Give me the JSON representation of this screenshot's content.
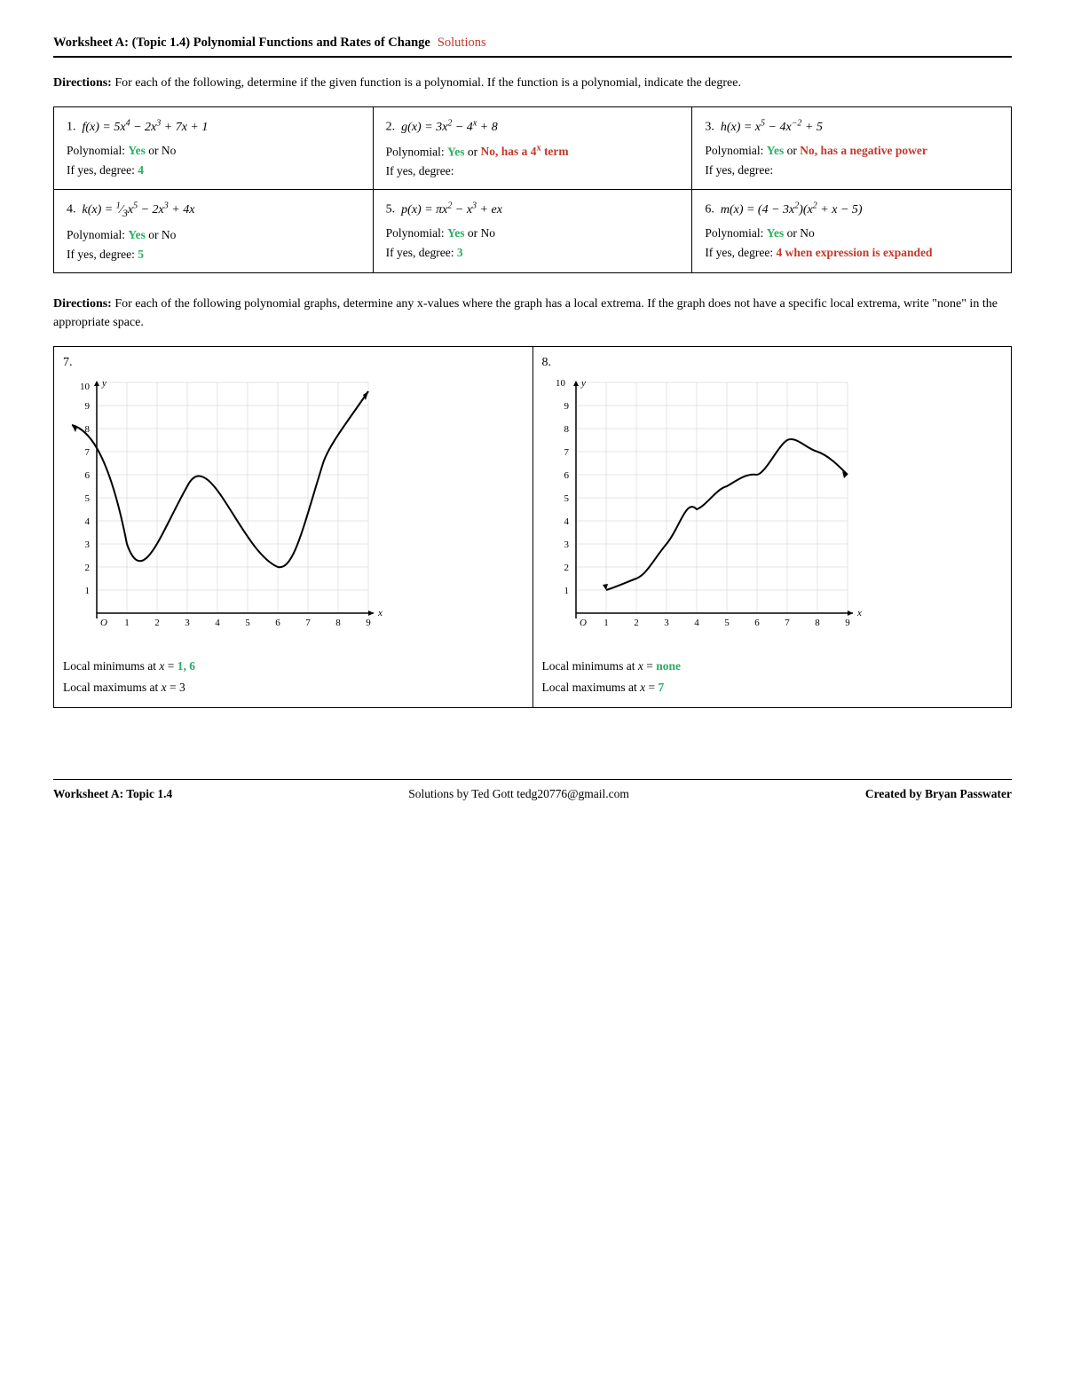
{
  "header": {
    "title": "Worksheet A: (Topic 1.4) Polynomial Functions and Rates of Change",
    "solutions": "Solutions"
  },
  "directions1": {
    "label": "Directions:",
    "text": "  For each of the following, determine if the given function is a polynomial.  If the function is a polynomial, indicate the degree."
  },
  "problems": [
    {
      "num": "1.",
      "func_label": "f",
      "func_expr": "(x) = 5x⁴ − 2x³ + 7x + 1",
      "poly_yes": "Yes",
      "poly_or": " or ",
      "poly_no": "No",
      "degree_label": "If yes, degree: ",
      "degree_val": "4",
      "degree_color": "green",
      "poly_note": ""
    },
    {
      "num": "2.",
      "func_label": "g",
      "func_expr": "(x) = 3x² − 4ˣ + 8",
      "poly_yes": "Yes",
      "poly_or": " or ",
      "poly_no": "No, has a 4ˣ term",
      "degree_label": "If yes, degree:",
      "degree_val": "",
      "degree_color": "red",
      "poly_note": ""
    },
    {
      "num": "3.",
      "func_label": "h",
      "func_expr": "(x) = x⁵ − 4x⁻² + 5",
      "poly_yes": "Yes",
      "poly_or": " or ",
      "poly_no": "No, has a negative power",
      "degree_label": "If yes, degree:",
      "degree_val": "",
      "degree_color": "red",
      "poly_note": ""
    },
    {
      "num": "4.",
      "func_label": "k",
      "func_expr": "(x) = ⅓x⁵ − 2x³ + 4x",
      "poly_yes": "Yes",
      "poly_or": " or ",
      "poly_no": "No",
      "degree_label": "If yes, degree: ",
      "degree_val": "5",
      "degree_color": "green",
      "poly_note": ""
    },
    {
      "num": "5.",
      "func_label": "p",
      "func_expr": "(x) = πx² − x³ + ex",
      "poly_yes": "Yes",
      "poly_or": " or ",
      "poly_no": "No",
      "degree_label": "If yes, degree: ",
      "degree_val": "3",
      "degree_color": "green",
      "poly_note": ""
    },
    {
      "num": "6.",
      "func_label": "m",
      "func_expr": "(x) = (4 − 3x²)(x² + x − 5)",
      "poly_yes": "Yes",
      "poly_or": " or ",
      "poly_no": "No",
      "degree_label": "If yes, degree: ",
      "degree_val": "4 when expression is expanded",
      "degree_color": "orange",
      "poly_note": ""
    }
  ],
  "directions2": {
    "label": "Directions:",
    "text": "  For each of the following polynomial graphs, determine any  x-values  where the graph has a local extrema. If the graph does not have a specific local extrema, write \"none\" in the appropriate space."
  },
  "graph7": {
    "num": "7.",
    "local_min_label": "Local minimums at x = ",
    "local_min_val": "1, 6",
    "local_max_label": "Local maximums at x = ",
    "local_max_val": "3"
  },
  "graph8": {
    "num": "8.",
    "local_min_label": "Local minimums at x = ",
    "local_min_val": "none",
    "local_max_label": "Local maximums at x = ",
    "local_max_val": "7"
  },
  "footer": {
    "left": "Worksheet A: Topic 1.4",
    "center": "Solutions by Ted Gott  tedg20776@gmail.com",
    "right": "Created by Bryan Passwater"
  }
}
